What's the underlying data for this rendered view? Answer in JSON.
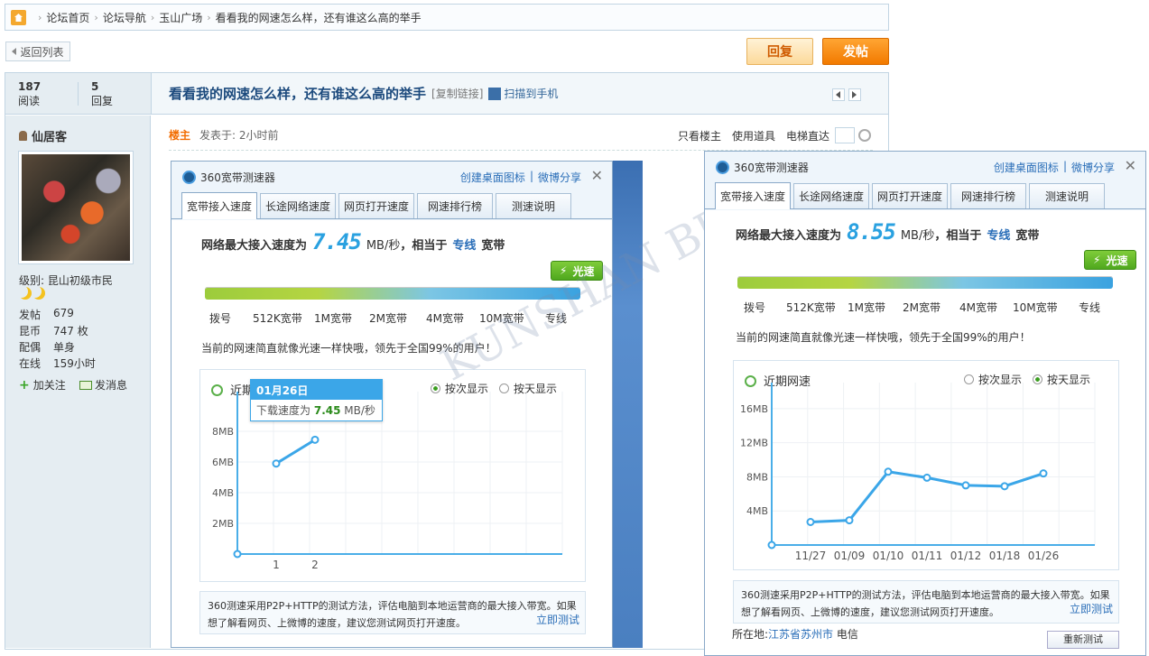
{
  "breadcrumb": {
    "items": [
      "论坛首页",
      "论坛导航",
      "玉山广场",
      "看看我的网速怎么样，还有谁这么高的举手"
    ]
  },
  "toolbar": {
    "back_label": "返回列表",
    "reply_label": "回复",
    "post_label": "发帖"
  },
  "thread": {
    "views": "187",
    "views_label": "阅读",
    "replies": "5",
    "replies_label": "回复",
    "title": "看看我的网速怎么样，还有谁这么高的举手",
    "copy_link": "[复制链接]",
    "scan": "扫描到手机"
  },
  "user": {
    "name": "仙居客",
    "level": "级别: 昆山初级市民",
    "stats": [
      {
        "k": "发帖",
        "v": "679"
      },
      {
        "k": "昆币",
        "v": "747 枚"
      },
      {
        "k": "配偶",
        "v": "单身"
      },
      {
        "k": "在线",
        "v": "159小时"
      }
    ],
    "follow": "加关注",
    "message": "发消息"
  },
  "post": {
    "op_tag": "楼主",
    "posted": "发表于: 2小时前",
    "tools": [
      "只看楼主",
      "使用道具",
      "电梯直达"
    ]
  },
  "watermark": "KUNSHAN BBS",
  "testers": [
    {
      "app_name": "360宽带测速器",
      "links": [
        "创建桌面图标",
        "微博分享"
      ],
      "close": "✕",
      "tabs": [
        "宽带接入速度",
        "长途网络速度",
        "网页打开速度",
        "网速排行榜",
        "测速说明"
      ],
      "speed_prefix": "网络最大接入速度为",
      "speed_value": "7.45",
      "speed_unit": "MB/秒",
      "speed_mid": "，相当于",
      "speed_type": "专线",
      "speed_suffix": "宽带",
      "badge": "光速",
      "scale": [
        "拨号",
        "512K宽带",
        "1M宽带",
        "2M宽带",
        "4M宽带",
        "10M宽带",
        "专线"
      ],
      "note": "当前的网速简直就像光速一样快哦，领先于全国99%的用户！",
      "chart_title": "近期网速",
      "radio_a": "按次显示",
      "radio_b": "按天显示",
      "selected": "a",
      "tooltip_title": "01月26日",
      "tooltip_prefix": "下载速度为",
      "tooltip_value": "7.45",
      "tooltip_unit": "MB/秒",
      "info": "360测速采用P2P+HTTP的测试方法，评估电脑到本地运营商的最大接入带宽。如果想了解看网页、上微博的速度，建议您测试网页打开速度。",
      "info_link": "立即测试",
      "chart_data": {
        "type": "line",
        "x": [
          "1",
          "2"
        ],
        "values": [
          5.9,
          7.45
        ],
        "ylim": [
          0,
          10
        ],
        "yticks": [
          "2MB",
          "4MB",
          "6MB",
          "8MB"
        ],
        "ytick_values": [
          2,
          4,
          6,
          8
        ],
        "xlabel": "",
        "ylabel": ""
      }
    },
    {
      "app_name": "360宽带测速器",
      "links": [
        "创建桌面图标",
        "微博分享"
      ],
      "close": "✕",
      "tabs": [
        "宽带接入速度",
        "长途网络速度",
        "网页打开速度",
        "网速排行榜",
        "测速说明"
      ],
      "speed_prefix": "网络最大接入速度为",
      "speed_value": "8.55",
      "speed_unit": "MB/秒",
      "speed_mid": "，相当于",
      "speed_type": "专线",
      "speed_suffix": "宽带",
      "badge": "光速",
      "scale": [
        "拨号",
        "512K宽带",
        "1M宽带",
        "2M宽带",
        "4M宽带",
        "10M宽带",
        "专线"
      ],
      "note": "当前的网速简直就像光速一样快哦，领先于全国99%的用户！",
      "chart_title": "近期网速",
      "radio_a": "按次显示",
      "radio_b": "按天显示",
      "selected": "b",
      "info": "360测速采用P2P+HTTP的测试方法，评估电脑到本地运营商的最大接入带宽。如果想了解看网页、上微博的速度，建议您测试网页打开速度。",
      "info_link": "立即测试",
      "chart_data": {
        "type": "line",
        "x": [
          "11/27",
          "01/09",
          "01/10",
          "01/11",
          "01/12",
          "01/18",
          "01/26"
        ],
        "values": [
          2.7,
          2.9,
          8.6,
          7.9,
          7.0,
          6.9,
          8.4
        ],
        "ylim": [
          0,
          18
        ],
        "yticks": [
          "4MB",
          "8MB",
          "12MB",
          "16MB"
        ],
        "ytick_values": [
          4,
          8,
          12,
          16
        ],
        "xlabel": "",
        "ylabel": ""
      }
    }
  ],
  "location": {
    "label": "所在地:",
    "place": "江苏省苏州市",
    "isp": "电信"
  },
  "retest": "重新测试"
}
